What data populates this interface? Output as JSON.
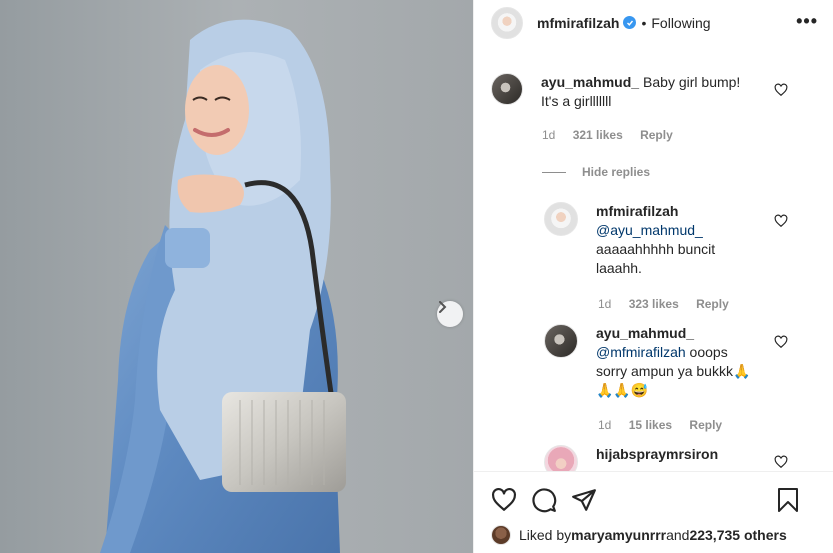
{
  "post": {
    "author": "mfmirafilzah",
    "follow_status": "Following",
    "dot": "•",
    "more": "•••"
  },
  "comments": [
    {
      "user": "ayu_mahmud_",
      "text_line1": "Baby girl bump!",
      "text_line2": "It's a girlllllll",
      "age": "1d",
      "likes": "321 likes",
      "reply": "Reply"
    },
    {
      "user": "mfmirafilzah",
      "mention": "@ayu_mahmud_",
      "text_line1": "aaaaahhhhh buncit",
      "text_line2": "laaahh.",
      "age": "1d",
      "likes": "323 likes",
      "reply": "Reply"
    },
    {
      "user": "ayu_mahmud_",
      "mention": "@mfmirafilzah",
      "text_line1": " ooops",
      "text_line2": "sorry ampun ya bukkk🙏",
      "text_line3": "🙏🙏😅",
      "age": "1d",
      "likes": "15 likes",
      "reply": "Reply"
    },
    {
      "user": "hijabspraymrsiron"
    }
  ],
  "hide_replies": "Hide replies",
  "likes_summary": {
    "prefix": "Liked by ",
    "user": "maryamyunrrr",
    "middle": " and ",
    "others": "223,735 others"
  },
  "colors": {
    "verified": "#3897f0",
    "mention": "#00376b",
    "muted": "#8e8e8e"
  },
  "icons": [
    "verified-badge-icon",
    "more-options-icon",
    "heart-icon",
    "comment-icon",
    "share-icon",
    "bookmark-icon",
    "chevron-right-icon"
  ]
}
